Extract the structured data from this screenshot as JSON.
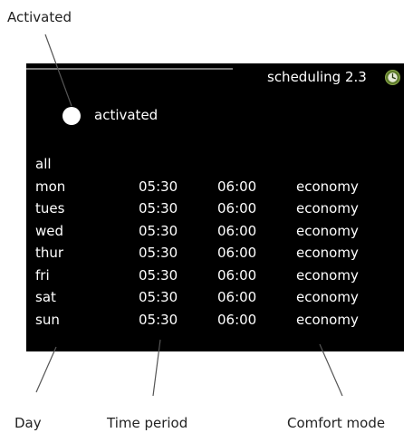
{
  "callouts": {
    "activated": "Activated",
    "day": "Day",
    "time_period": "Time period",
    "comfort_mode": "Comfort mode"
  },
  "screen": {
    "title": "scheduling 2.3",
    "icon": "clock-icon",
    "status_label": "activated",
    "all_label": "all",
    "schedule": [
      {
        "day": "mon",
        "start": "05:30",
        "end": "06:00",
        "mode": "economy"
      },
      {
        "day": "tues",
        "start": "05:30",
        "end": "06:00",
        "mode": "economy"
      },
      {
        "day": "wed",
        "start": "05:30",
        "end": "06:00",
        "mode": "economy"
      },
      {
        "day": "thur",
        "start": "05:30",
        "end": "06:00",
        "mode": "economy"
      },
      {
        "day": "fri",
        "start": "05:30",
        "end": "06:00",
        "mode": "economy"
      },
      {
        "day": "sat",
        "start": "05:30",
        "end": "06:00",
        "mode": "economy"
      },
      {
        "day": "sun",
        "start": "05:30",
        "end": "06:00",
        "mode": "economy"
      }
    ]
  },
  "colors": {
    "screen_background": "#000000",
    "screen_text": "#ffffff",
    "icon_green": "#5d7a2a"
  }
}
